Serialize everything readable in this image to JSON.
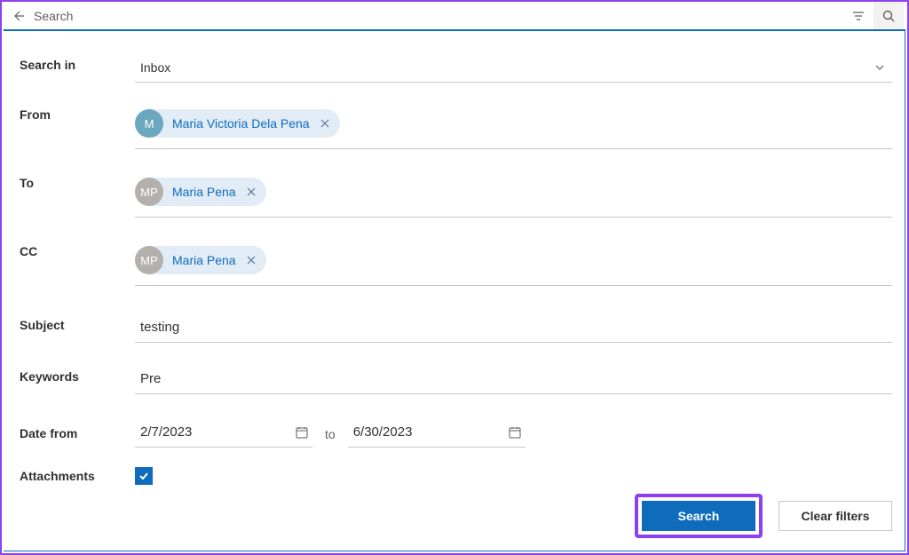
{
  "header": {
    "title": "Search"
  },
  "labels": {
    "searchIn": "Search in",
    "from": "From",
    "to": "To",
    "cc": "CC",
    "subject": "Subject",
    "keywords": "Keywords",
    "dateFrom": "Date from",
    "dateTo": "to",
    "attachments": "Attachments"
  },
  "values": {
    "searchIn": "Inbox",
    "subject": "testing",
    "keywords": "Pre",
    "dateFrom": "2/7/2023",
    "dateTo": "6/30/2023",
    "attachmentsChecked": true
  },
  "fromChips": [
    {
      "initials": "M",
      "name": "Maria Victoria Dela Pena",
      "style": "blue"
    }
  ],
  "toChips": [
    {
      "initials": "MP",
      "name": "Maria Pena",
      "style": "gray"
    }
  ],
  "ccChips": [
    {
      "initials": "MP",
      "name": "Maria Pena",
      "style": "gray"
    }
  ],
  "buttons": {
    "search": "Search",
    "clear": "Clear filters"
  }
}
